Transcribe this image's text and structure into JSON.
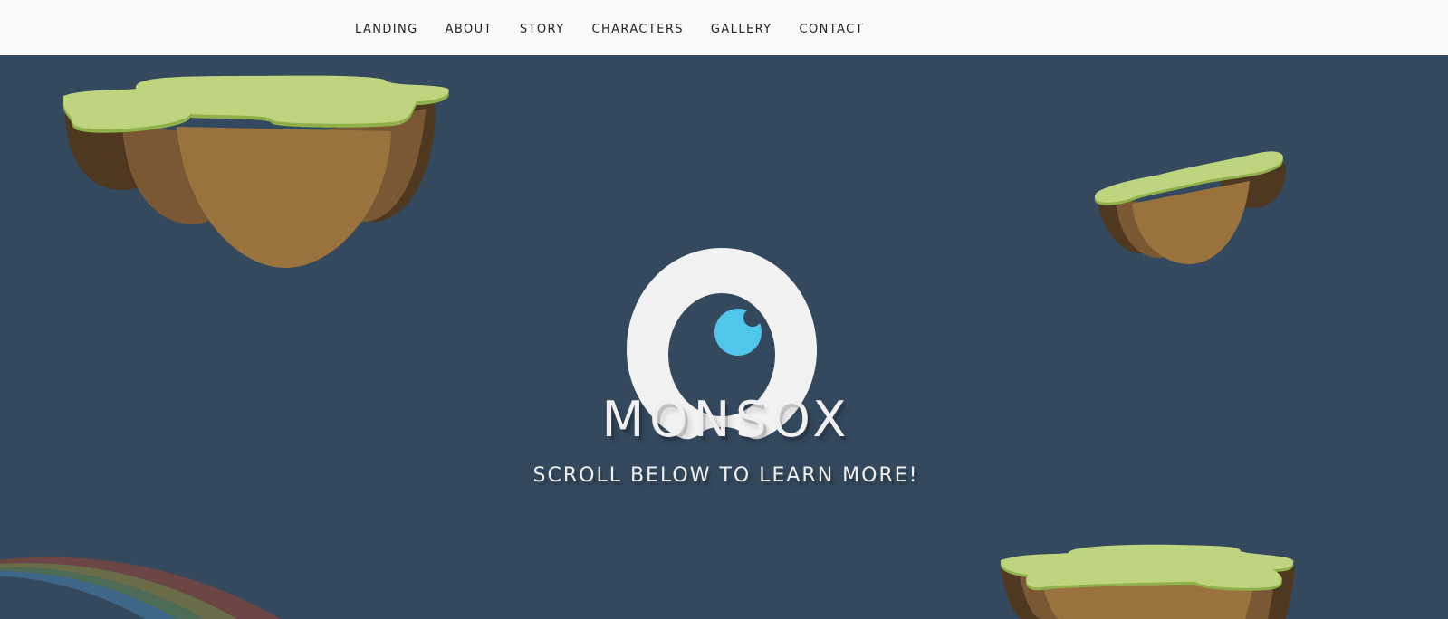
{
  "nav": {
    "items": [
      {
        "label": "LANDING"
      },
      {
        "label": "ABOUT"
      },
      {
        "label": "STORY"
      },
      {
        "label": "CHARACTERS"
      },
      {
        "label": "GALLERY"
      },
      {
        "label": "CONTACT"
      }
    ]
  },
  "hero": {
    "title": "MONSOX",
    "subtitle": "SCROLL BELOW TO LEARN MORE!"
  },
  "colors": {
    "nav_bg": "#f9f9f9",
    "hero_bg": "#34495e",
    "grass": "#bfd47f",
    "grass_edge": "#8fb04a",
    "dirt_light": "#9a723d",
    "dirt_mid": "#7a5833",
    "dirt_dark": "#4e3820",
    "logo_white": "#f2f2f2",
    "eye_blue": "#4fc6ea",
    "rainbow_red": "#6c4545",
    "rainbow_olive": "#6a6c47",
    "rainbow_green": "#4e6b56",
    "rainbow_blue": "#3e6688"
  },
  "icons": {
    "logo": "monsox-eye-logo",
    "islands": [
      "floating-island-icon",
      "floating-island-icon",
      "floating-island-icon"
    ],
    "rainbow": "rainbow-icon"
  }
}
